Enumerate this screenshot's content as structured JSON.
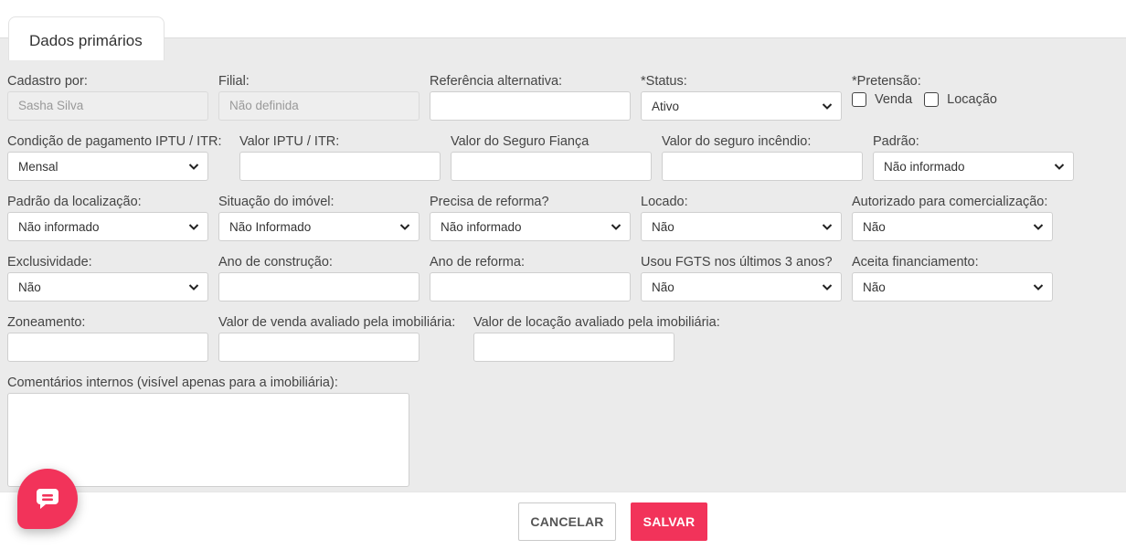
{
  "tab": {
    "label": "Dados primários"
  },
  "form": {
    "cadastro_por": {
      "label": "Cadastro por:",
      "value": "Sasha Silva"
    },
    "filial": {
      "label": "Filial:",
      "value": "Não definida"
    },
    "referencia": {
      "label": "Referência alternativa:",
      "value": ""
    },
    "status": {
      "label": "*Status:",
      "value": "Ativo"
    },
    "pretensao": {
      "label": "*Pretensão:",
      "venda": "Venda",
      "locacao": "Locação"
    },
    "condicao_pagamento": {
      "label": "Condição de pagamento IPTU / ITR:",
      "value": "Mensal"
    },
    "valor_iptu": {
      "label": "Valor IPTU / ITR:",
      "value": ""
    },
    "valor_seguro_fianca": {
      "label": "Valor do Seguro Fiança",
      "value": ""
    },
    "valor_seguro_incendio": {
      "label": "Valor do seguro incêndio:",
      "value": ""
    },
    "padrao": {
      "label": "Padrão:",
      "value": "Não informado"
    },
    "padrao_localizacao": {
      "label": "Padrão da localização:",
      "value": "Não informado"
    },
    "situacao_imovel": {
      "label": "Situação do imóvel:",
      "value": "Não Informado"
    },
    "precisa_reforma": {
      "label": "Precisa de reforma?",
      "value": "Não informado"
    },
    "locado": {
      "label": "Locado:",
      "value": "Não"
    },
    "autorizado": {
      "label": "Autorizado para comercialização:",
      "value": "Não"
    },
    "exclusividade": {
      "label": "Exclusividade:",
      "value": "Não"
    },
    "ano_construcao": {
      "label": "Ano de construção:",
      "value": ""
    },
    "ano_reforma": {
      "label": "Ano de reforma:",
      "value": ""
    },
    "usou_fgts": {
      "label": "Usou FGTS nos últimos 3 anos?",
      "value": "Não"
    },
    "aceita_financiamento": {
      "label": "Aceita financiamento:",
      "value": "Não"
    },
    "zoneamento": {
      "label": "Zoneamento:",
      "value": ""
    },
    "valor_venda_avaliado": {
      "label": "Valor de venda avaliado pela imobiliária:",
      "value": ""
    },
    "valor_locacao_avaliado": {
      "label": "Valor de locação avaliado pela imobiliária:",
      "value": ""
    },
    "comentarios": {
      "label": "Comentários internos (visível apenas para a imobiliária):",
      "value": ""
    }
  },
  "footer": {
    "cancel_label": "CANCELAR",
    "save_label": "SALVAR"
  },
  "colors": {
    "accent": "#f2335a",
    "panel": "#ebebeb"
  },
  "icons": {
    "chat": "chat-bubble-icon",
    "select": "chevron-down-icon"
  }
}
